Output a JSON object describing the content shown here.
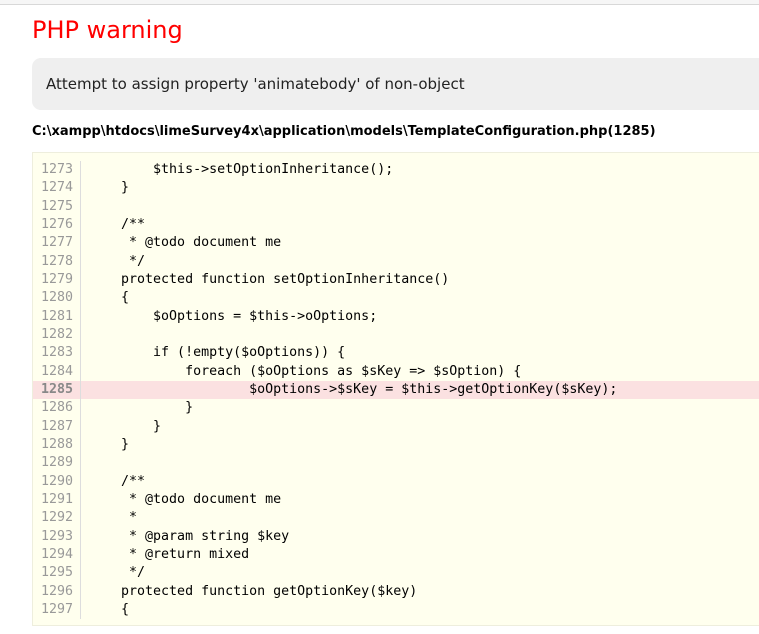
{
  "title": "PHP warning",
  "message": "Attempt to assign property 'animatebody' of non-object",
  "file": "C:\\xampp\\htdocs\\limeSurvey4x\\application\\models\\TemplateConfiguration.php(1285)",
  "highlight_line": "1285",
  "lines": [
    {
      "n": "1273",
      "code": "        $this->setOptionInheritance();"
    },
    {
      "n": "1274",
      "code": "    }"
    },
    {
      "n": "1275",
      "code": ""
    },
    {
      "n": "1276",
      "code": "    /**"
    },
    {
      "n": "1277",
      "code": "     * @todo document me"
    },
    {
      "n": "1278",
      "code": "     */"
    },
    {
      "n": "1279",
      "code": "    protected function setOptionInheritance()"
    },
    {
      "n": "1280",
      "code": "    {"
    },
    {
      "n": "1281",
      "code": "        $oOptions = $this->oOptions;"
    },
    {
      "n": "1282",
      "code": ""
    },
    {
      "n": "1283",
      "code": "        if (!empty($oOptions)) {"
    },
    {
      "n": "1284",
      "code": "            foreach ($oOptions as $sKey => $sOption) {"
    },
    {
      "n": "1285",
      "code": "                    $oOptions->$sKey = $this->getOptionKey($sKey);"
    },
    {
      "n": "1286",
      "code": "            }"
    },
    {
      "n": "1287",
      "code": "        }"
    },
    {
      "n": "1288",
      "code": "    }"
    },
    {
      "n": "1289",
      "code": ""
    },
    {
      "n": "1290",
      "code": "    /**"
    },
    {
      "n": "1291",
      "code": "     * @todo document me"
    },
    {
      "n": "1292",
      "code": "     *"
    },
    {
      "n": "1293",
      "code": "     * @param string $key"
    },
    {
      "n": "1294",
      "code": "     * @return mixed"
    },
    {
      "n": "1295",
      "code": "     */"
    },
    {
      "n": "1296",
      "code": "    protected function getOptionKey($key)"
    },
    {
      "n": "1297",
      "code": "    {"
    }
  ]
}
